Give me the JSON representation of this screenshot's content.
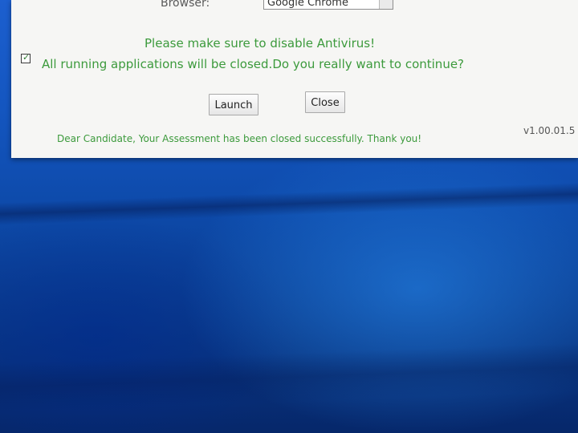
{
  "form": {
    "browser_label": "Browser:",
    "browser_value": "Google Chrome"
  },
  "dialog": {
    "warning_line1": "Please make sure to disable Antivirus!",
    "warning_line2": "All running applications will be closed.Do you really want to continue?",
    "confirm_checked": true,
    "launch_label": "Launch",
    "close_label": "Close",
    "status_message": "Dear Candidate, Your Assessment has been closed successfully. Thank you!",
    "version": "v1.00.01.5"
  },
  "colors": {
    "message_green": "#3c9a3c",
    "window_bg": "#f6f6f4",
    "desktop_blue": "#1456c0"
  }
}
